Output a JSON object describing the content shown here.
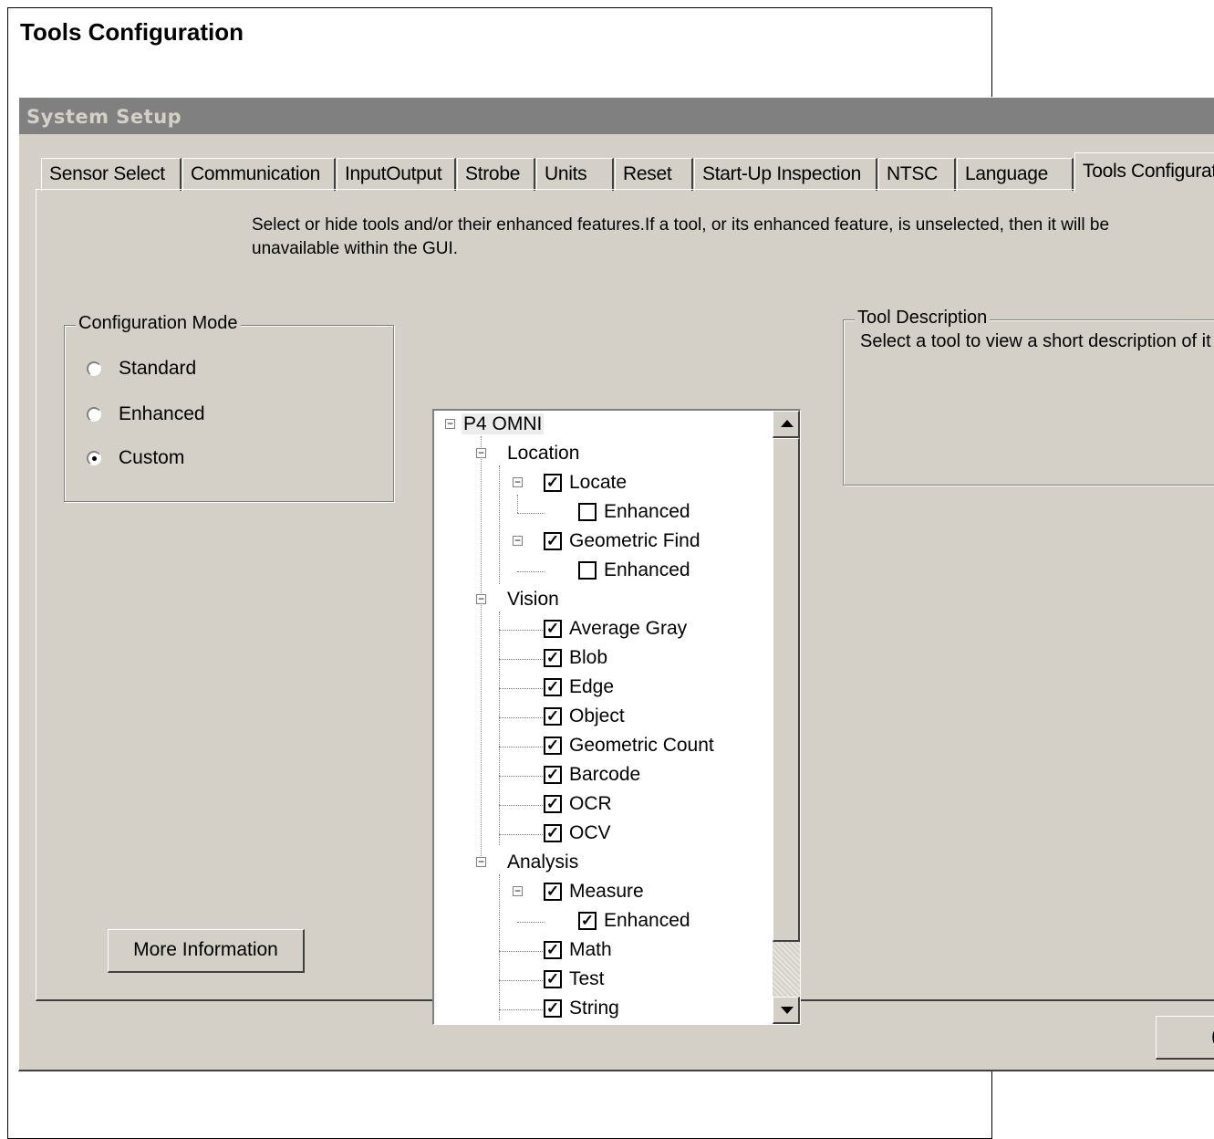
{
  "document": {
    "title": "Tools Configuration"
  },
  "dialog": {
    "title": "System Setup",
    "tabs": [
      {
        "label": "Sensor Select"
      },
      {
        "label": "Communication"
      },
      {
        "label": "InputOutput"
      },
      {
        "label": "Strobe"
      },
      {
        "label": "Units"
      },
      {
        "label": "Reset"
      },
      {
        "label": "Start-Up Inspection"
      },
      {
        "label": "NTSC"
      },
      {
        "label": "Language"
      },
      {
        "label": "Tools Configurat",
        "active": true
      }
    ],
    "instructions": "Select or hide tools and/or their enhanced features.If a tool, or its enhanced feature, is unselected, then it will be unavailable within the GUI.",
    "config_mode": {
      "label": "Configuration Mode",
      "options": [
        {
          "label": "Standard",
          "selected": false
        },
        {
          "label": "Enhanced",
          "selected": false
        },
        {
          "label": "Custom",
          "selected": true
        }
      ]
    },
    "more_info_label": "More Information",
    "tree": {
      "root": "P4 OMNI",
      "location": "Location",
      "locate": "Locate",
      "locate_enhanced": "Enhanced",
      "geometric_find": "Geometric Find",
      "geometric_find_enhanced": "Enhanced",
      "vision": "Vision",
      "average_gray": "Average Gray",
      "blob": "Blob",
      "edge": "Edge",
      "object": "Object",
      "geometric_count": "Geometric Count",
      "barcode": "Barcode",
      "ocr": "OCR",
      "ocv": "OCV",
      "analysis": "Analysis",
      "measure": "Measure",
      "measure_enhanced": "Enhanced",
      "math": "Math",
      "test": "Test",
      "string": "String"
    },
    "tool_description": {
      "label": "Tool Description",
      "text": "Select a tool to view a short description of it"
    },
    "ok_button_fragment": "("
  }
}
